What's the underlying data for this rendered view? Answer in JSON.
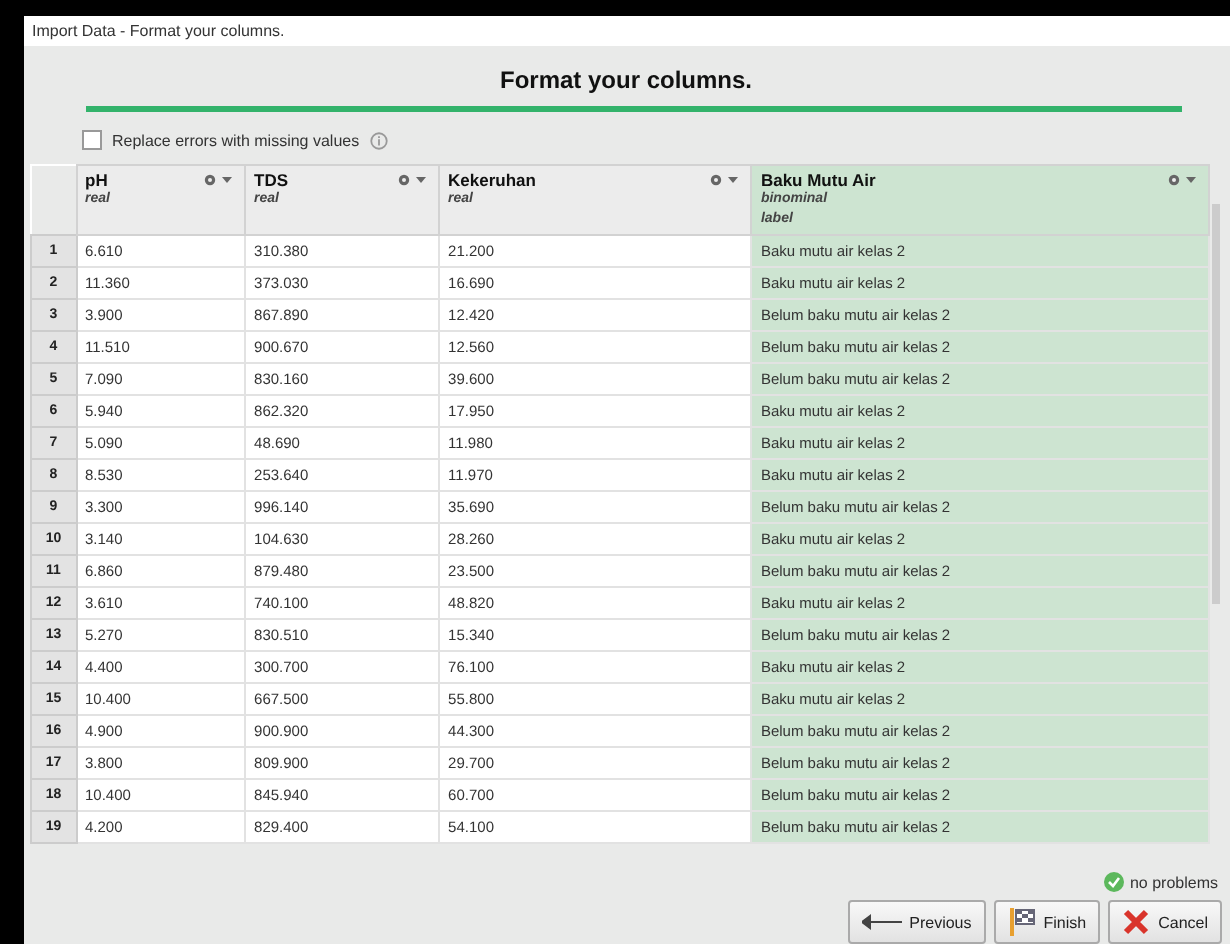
{
  "window": {
    "title": "Import Data - Format your columns."
  },
  "heading": "Format your columns.",
  "replace_errors": {
    "label": "Replace errors with missing values",
    "checked": false
  },
  "table": {
    "columns": [
      {
        "name": "pH",
        "type": "real"
      },
      {
        "name": "TDS",
        "type": "real"
      },
      {
        "name": "Kekeruhan",
        "type": "real"
      },
      {
        "name": "Baku Mutu Air",
        "type": "binominal",
        "role": "label"
      }
    ],
    "rows": [
      {
        "number": "1",
        "cells": [
          "6.610",
          "310.380",
          "21.200",
          "Baku mutu air kelas 2"
        ]
      },
      {
        "number": "2",
        "cells": [
          "11.360",
          "373.030",
          "16.690",
          "Baku mutu air kelas 2"
        ]
      },
      {
        "number": "3",
        "cells": [
          "3.900",
          "867.890",
          "12.420",
          "Belum baku mutu air kelas 2"
        ]
      },
      {
        "number": "4",
        "cells": [
          "11.510",
          "900.670",
          "12.560",
          "Belum baku mutu air kelas 2"
        ]
      },
      {
        "number": "5",
        "cells": [
          "7.090",
          "830.160",
          "39.600",
          "Belum baku mutu air kelas 2"
        ]
      },
      {
        "number": "6",
        "cells": [
          "5.940",
          "862.320",
          "17.950",
          "Baku mutu air kelas 2"
        ]
      },
      {
        "number": "7",
        "cells": [
          "5.090",
          "48.690",
          "11.980",
          "Baku mutu air kelas 2"
        ]
      },
      {
        "number": "8",
        "cells": [
          "8.530",
          "253.640",
          "11.970",
          "Baku mutu air kelas 2"
        ]
      },
      {
        "number": "9",
        "cells": [
          "3.300",
          "996.140",
          "35.690",
          "Belum baku mutu air kelas 2"
        ]
      },
      {
        "number": "10",
        "cells": [
          "3.140",
          "104.630",
          "28.260",
          "Baku mutu air kelas 2"
        ]
      },
      {
        "number": "11",
        "cells": [
          "6.860",
          "879.480",
          "23.500",
          "Belum baku mutu air kelas 2"
        ]
      },
      {
        "number": "12",
        "cells": [
          "3.610",
          "740.100",
          "48.820",
          "Baku mutu air kelas 2"
        ]
      },
      {
        "number": "13",
        "cells": [
          "5.270",
          "830.510",
          "15.340",
          "Belum baku mutu air kelas 2"
        ]
      },
      {
        "number": "14",
        "cells": [
          "4.400",
          "300.700",
          "76.100",
          "Baku mutu air kelas 2"
        ]
      },
      {
        "number": "15",
        "cells": [
          "10.400",
          "667.500",
          "55.800",
          "Baku mutu air kelas 2"
        ]
      },
      {
        "number": "16",
        "cells": [
          "4.900",
          "900.900",
          "44.300",
          "Belum baku mutu air kelas 2"
        ]
      },
      {
        "number": "17",
        "cells": [
          "3.800",
          "809.900",
          "29.700",
          "Belum baku mutu air kelas 2"
        ]
      },
      {
        "number": "18",
        "cells": [
          "10.400",
          "845.940",
          "60.700",
          "Belum baku mutu air kelas 2"
        ]
      },
      {
        "number": "19",
        "cells": [
          "4.200",
          "829.400",
          "54.100",
          "Belum baku mutu air kelas 2"
        ]
      }
    ]
  },
  "status": "no problems",
  "buttons": [
    {
      "kind": "previous",
      "label": "Previous"
    },
    {
      "kind": "finish",
      "label": "Finish"
    },
    {
      "kind": "cancel",
      "label": "Cancel"
    }
  ]
}
